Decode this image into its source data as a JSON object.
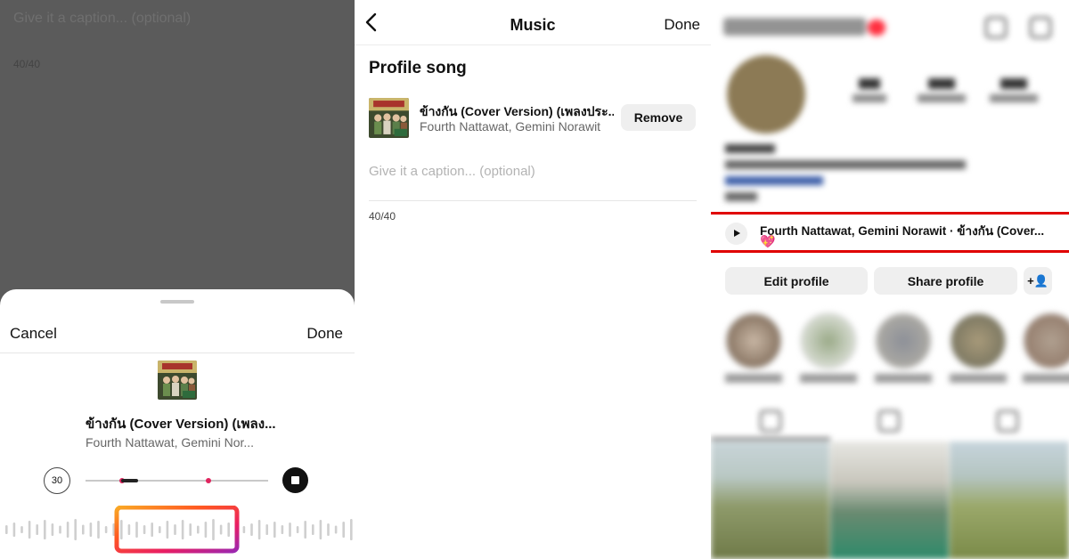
{
  "panel1": {
    "dim_caption_placeholder": "Give it a caption... (optional)",
    "dim_counter": "40/40",
    "cancel_label": "Cancel",
    "done_label": "Done",
    "song_title": "ข้างกัน (Cover Version) (เพลง...",
    "song_artist": "Fourth Nattawat, Gemini Nor...",
    "clip_length": "30",
    "play_state_icon": "stop-icon",
    "selection_gradient": [
      "#f9a825",
      "#ff5722",
      "#e91e63",
      "#9c27b0"
    ]
  },
  "panel2": {
    "nav_title": "Music",
    "nav_done": "Done",
    "section_title": "Profile song",
    "song_title": "ข้างกัน (Cover Version) (เพลงประ...",
    "song_artist": "Fourth Nattawat, Gemini Norawit",
    "remove_label": "Remove",
    "caption_placeholder": "Give it a caption... (optional)",
    "counter": "40/40"
  },
  "panel3": {
    "music_line": "Fourth Nattawat, Gemini Norawit · ข้างกัน (Cover...",
    "music_emoji": "💖",
    "edit_profile_label": "Edit profile",
    "share_profile_label": "Share profile",
    "add_user_icon": "+👤",
    "highlight_color": "#e00000"
  }
}
